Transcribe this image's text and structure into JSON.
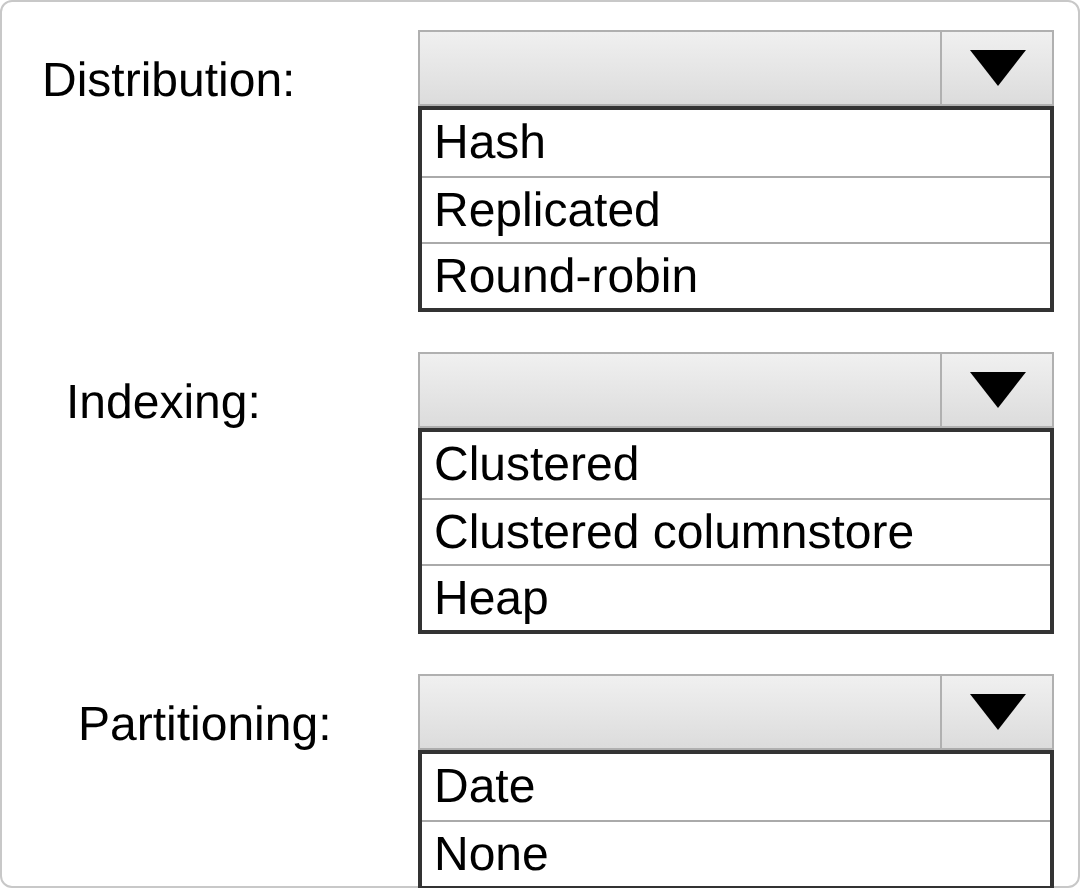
{
  "groups": [
    {
      "label": "Distribution:",
      "options": [
        "Hash",
        "Replicated",
        "Round-robin"
      ]
    },
    {
      "label": "Indexing:",
      "options": [
        "Clustered",
        "Clustered columnstore",
        "Heap"
      ]
    },
    {
      "label": "Partitioning:",
      "options": [
        "Date",
        "None"
      ]
    }
  ]
}
